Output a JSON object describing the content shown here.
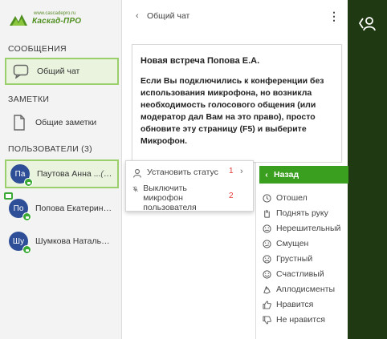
{
  "logo": {
    "url": "www.cascadepro.ru",
    "name": "Каскад-ПРО"
  },
  "sidebar": {
    "messages_title": "СООБЩЕНИЯ",
    "general_chat": "Общий чат",
    "notes_title": "ЗАМЕТКИ",
    "general_notes": "Общие заметки",
    "users_title": "ПОЛЬЗОВАТЕЛИ",
    "users_count": "(3)",
    "users": [
      {
        "initials": "Па",
        "name": "Паутова Анна ...",
        "suffix": "(Вы)",
        "active": true
      },
      {
        "initials": "По",
        "name": "Попова Екатерина...",
        "suffix": "",
        "active": false
      },
      {
        "initials": "Шу",
        "name": "Шумкова Наталья ...",
        "suffix": "",
        "active": false
      }
    ]
  },
  "chat": {
    "title": "Общий чат",
    "message_title": "Новая встреча Попова Е.А.",
    "message_body": "Если Вы подключились к конференции без использования микрофона, но возникла необходимость голосового общения (или модератор дал Вам на это право), просто обновите эту страницу (F5) и выберите Микрофон."
  },
  "context_menu": {
    "set_status": "Установить статус",
    "set_status_num": "1",
    "mute": "Выключить микрофон пользователя",
    "mute_num": "2"
  },
  "status_menu": {
    "back": "Назад",
    "items": [
      "Отошел",
      "Поднять руку",
      "Нерешительный",
      "Смущен",
      "Грустный",
      "Счастливый",
      "Аплодисменты",
      "Нравится",
      "Не нравится"
    ]
  },
  "colors": {
    "accent": "#3a9e1e",
    "dark_strip": "#1f3a12",
    "avatar": "#2e4f97"
  }
}
